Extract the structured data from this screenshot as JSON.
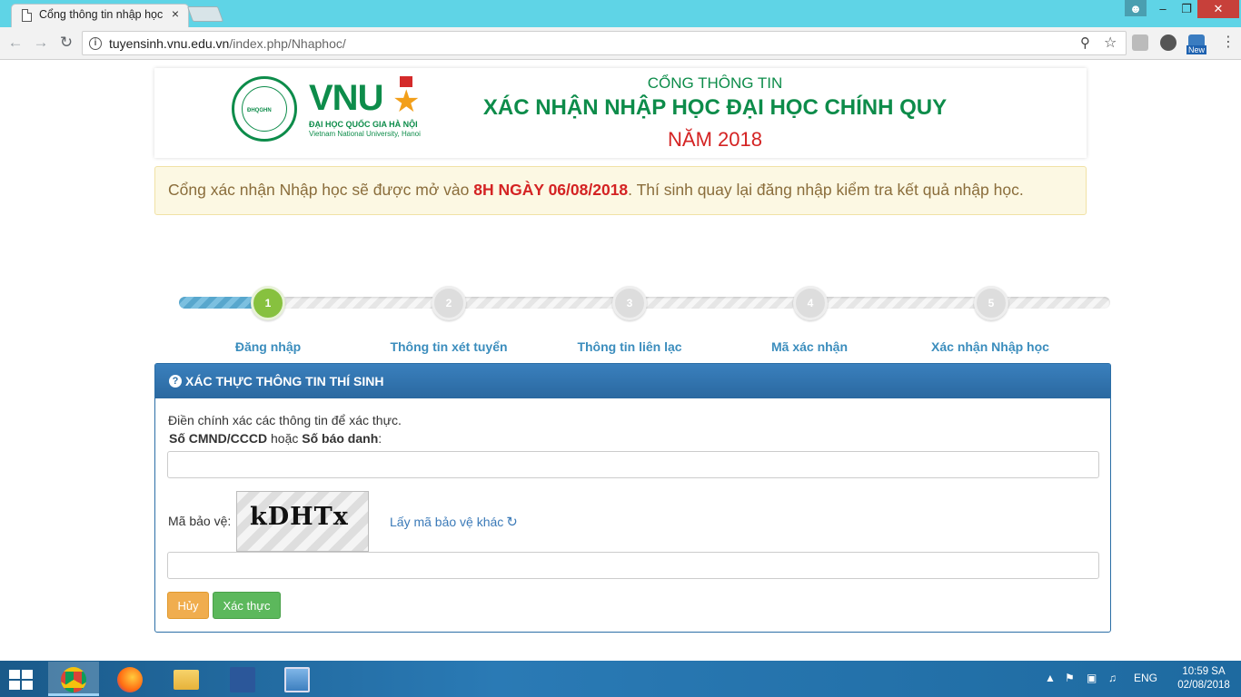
{
  "browser": {
    "tab_title": "Cổng thông tin nhập học",
    "tab_close": "×",
    "url_domain": "tuyensinh.vnu.edu.vn",
    "url_path": "/index.php/Nhaphoc/",
    "ext_badge": "New"
  },
  "header": {
    "logo_text": "VNU",
    "logo_circle_text": "ĐHQGHN",
    "logo_sub1": "ĐẠI HỌC QUỐC GIA HÀ NỘI",
    "logo_sub2": "Vietnam National University, Hanoi",
    "line1": "CỔNG THÔNG TIN",
    "line2": "XÁC NHẬN NHẬP HỌC ĐẠI HỌC CHÍNH QUY",
    "line3": "NĂM 2018"
  },
  "notice": {
    "before": "Cổng xác nhận Nhập học sẽ được mở vào ",
    "highlight": "8H NGÀY 06/08/2018",
    "after": ". Thí sinh quay lại đăng nhập kiểm tra kết quả nhập học."
  },
  "steps": [
    {
      "number": "1",
      "label": "Đăng nhập"
    },
    {
      "number": "2",
      "label": "Thông tin xét tuyển"
    },
    {
      "number": "3",
      "label": "Thông tin liên lạc"
    },
    {
      "number": "4",
      "label": "Mã xác nhận"
    },
    {
      "number": "5",
      "label": "Xác nhận Nhập học"
    }
  ],
  "panel": {
    "title": "XÁC THỰC THÔNG TIN THÍ SINH",
    "intro": "Điền chính xác các thông tin để xác thực.",
    "label_id_bold1": "Số CMND/CCCD",
    "label_id_mid": " hoặc ",
    "label_id_bold2": "Số báo danh",
    "label_id_end": ":",
    "id_value": "",
    "captcha_label": "Mã bảo vệ:",
    "captcha_code": "kDHTx",
    "refresh_label": "Lấy mã bảo vệ khác",
    "captcha_value": "",
    "cancel_label": "Hủy",
    "submit_label": "Xác thực"
  },
  "taskbar": {
    "lang": "ENG",
    "time": "10:59 SA",
    "date": "02/08/2018"
  },
  "colors": {
    "vnu_green": "#0d8c4a",
    "red": "#d42323",
    "panel_blue": "#2b6ea6",
    "step_active": "#87c13f",
    "cancel": "#f0ad4e",
    "submit": "#5cb85c"
  }
}
